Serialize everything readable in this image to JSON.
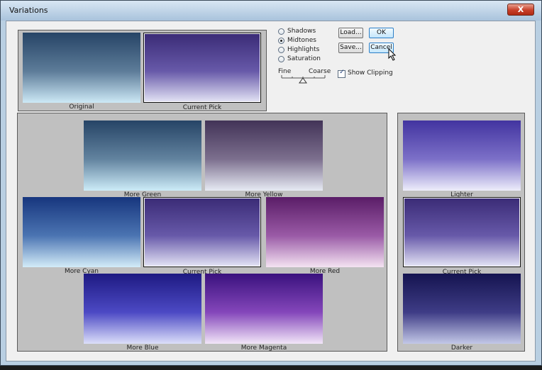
{
  "window": {
    "title": "Variations",
    "close_label": "X"
  },
  "top_thumbs": [
    {
      "label": "Original"
    },
    {
      "label": "Current Pick"
    }
  ],
  "options": {
    "radios": [
      {
        "label": "Shadows",
        "selected": false
      },
      {
        "label": "Midtones",
        "selected": true
      },
      {
        "label": "Highlights",
        "selected": false
      },
      {
        "label": "Saturation",
        "selected": false
      }
    ],
    "slider": {
      "min_label": "Fine",
      "max_label": "Coarse",
      "value_fraction": 0.5
    },
    "show_clipping": {
      "label": "Show Clipping",
      "checked": true
    }
  },
  "buttons": {
    "load": "Load...",
    "save": "Save...",
    "ok": "OK",
    "cancel": "Cancel"
  },
  "color_variations": [
    {
      "label": "More Green"
    },
    {
      "label": "More Yellow"
    },
    {
      "label": "More Cyan"
    },
    {
      "label": "Current Pick"
    },
    {
      "label": "More Red"
    },
    {
      "label": "More Blue"
    },
    {
      "label": "More Magenta"
    }
  ],
  "brightness_variations": [
    {
      "label": "Lighter"
    },
    {
      "label": "Current Pick"
    },
    {
      "label": "Darker"
    }
  ],
  "colors": {
    "accent": "#2d7fc7",
    "panel_bg": "#c0c0c0",
    "dialog_bg": "#f0f0f0"
  }
}
